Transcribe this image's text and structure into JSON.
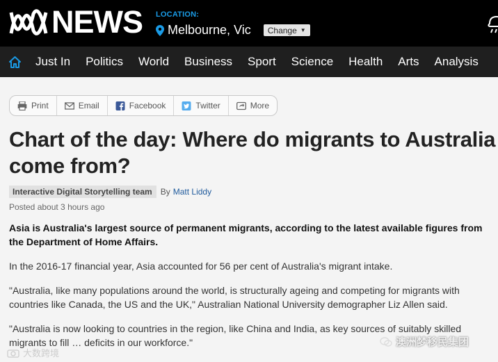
{
  "header": {
    "logo_text": "NEWS",
    "location_label": "LOCATION:",
    "location_city": "Melbourne, Vic",
    "change_label": "Change"
  },
  "nav": {
    "items": [
      "Just In",
      "Politics",
      "World",
      "Business",
      "Sport",
      "Science",
      "Health",
      "Arts",
      "Analysis"
    ]
  },
  "share": {
    "buttons": [
      "Print",
      "Email",
      "Facebook",
      "Twitter",
      "More"
    ]
  },
  "article": {
    "title": "Chart of the day: Where do migrants to Australia come from?",
    "team": "Interactive Digital Storytelling team",
    "by_label": "By",
    "author": "Matt Liddy",
    "posted": "Posted about 3 hours ago",
    "lead": "Asia is Australia's largest source of permanent migrants, according to the latest available figures from the Department of Home Affairs.",
    "paragraphs": [
      "In the 2016-17 financial year, Asia accounted for 56 per cent of Australia's migrant intake.",
      "\"Australia, like many populations around the world, is structurally ageing and competing for migrants with countries like Canada, the US and the UK,\" Australian National University demographer Liz Allen said.",
      "\"Australia is now looking to countries in the region, like China and India, as key sources of suitably skilled migrants to fill … deficits in our workforce.\""
    ]
  },
  "watermarks": {
    "left": "大数跨境",
    "right": "澳洲梦移民集团"
  },
  "colors": {
    "header_bg": "#000000",
    "nav_bg": "#1f1f1f",
    "accent": "#1a9be6",
    "link": "#1f5a9c"
  }
}
